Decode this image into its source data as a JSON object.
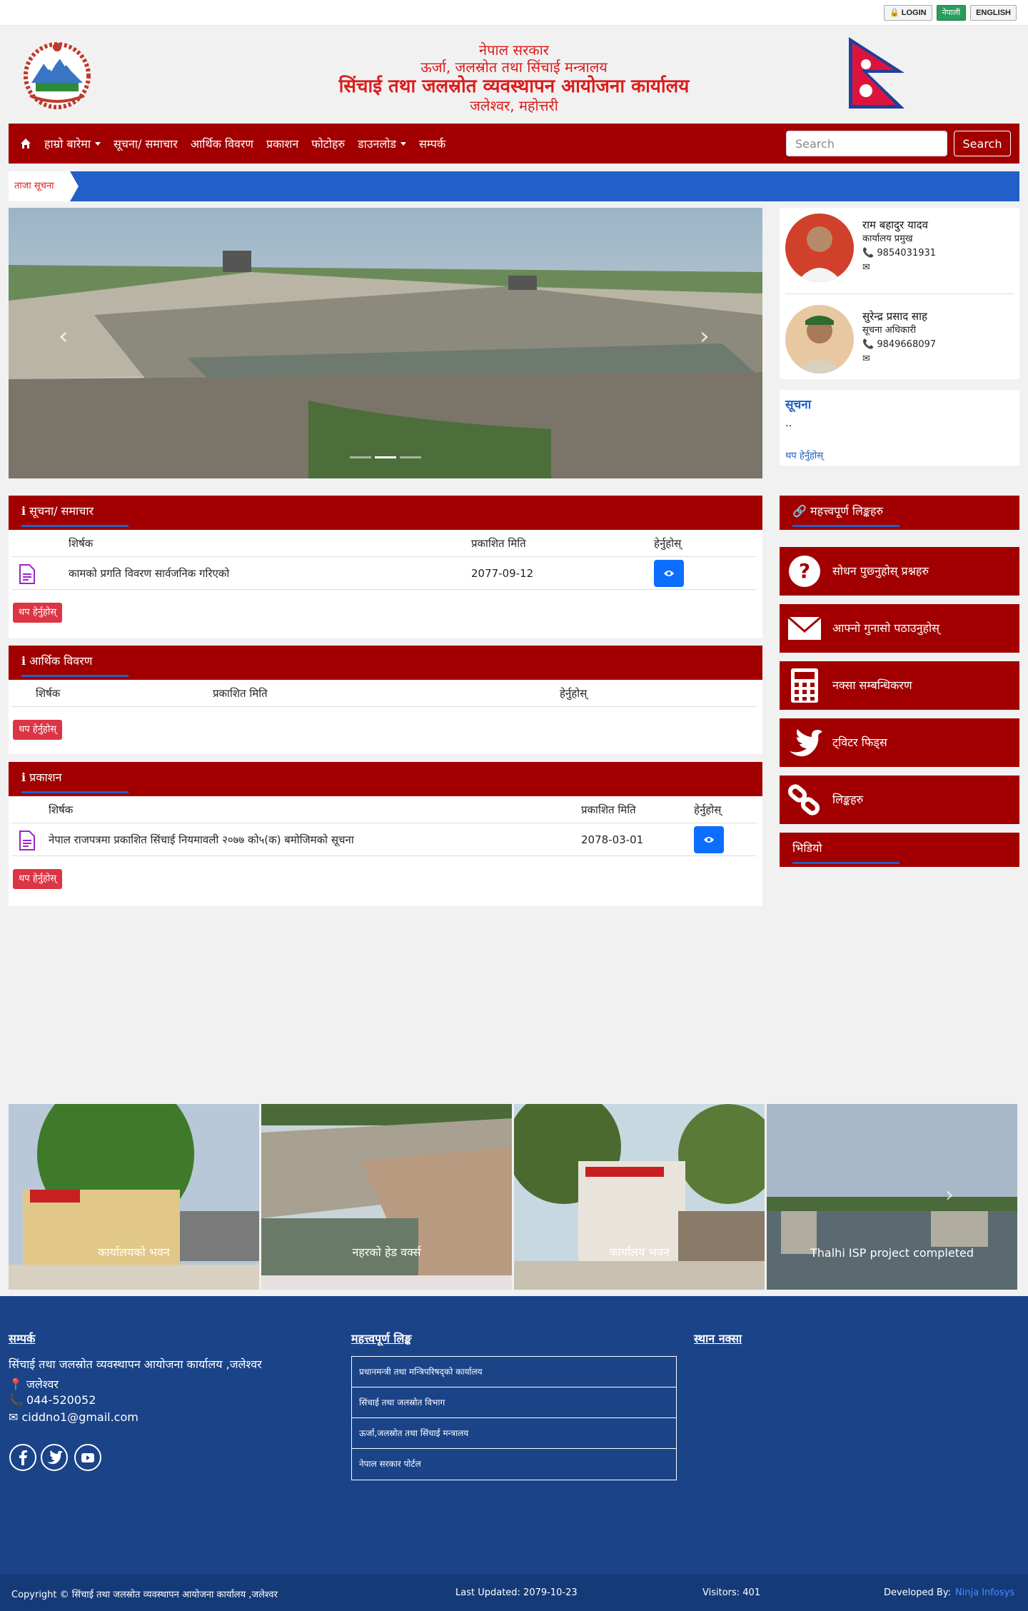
{
  "topbar": {
    "login": "🔒 LOGIN",
    "nepali": "नेपाली",
    "english": "ENGLISH"
  },
  "header": {
    "line1": "नेपाल सरकार",
    "line2": "ऊर्जा, जलस्रोत तथा सिंचाई मन्त्रालय",
    "line3": "सिंचाई तथा जलस्रोत व्यवस्थापन आयोजना कार्यालय",
    "line4": "जलेश्वर, महोत्तरी"
  },
  "nav": {
    "home_icon": "home-icon",
    "items": [
      "हाम्रो बारेमा",
      "सूचना/ समाचार",
      "आर्थिक विवरण",
      "प्रकाशन",
      "फोटोहरु",
      "डाउनलोड",
      "सम्पर्क"
    ],
    "search_placeholder": "Search",
    "search_button": "Search"
  },
  "ticker": {
    "label": "ताजा सूचना"
  },
  "staff": [
    {
      "name": "राम बहादुर यादव",
      "role": "कार्यालय प्रमुख",
      "phone": "📞 9854031931",
      "email": "✉"
    },
    {
      "name": "सुरेन्द्र प्रसाद साह",
      "role": "सूचना अधिकारी",
      "phone": "📞 9849668097",
      "email": "✉"
    }
  ],
  "notice": {
    "title": "सूचना",
    "text": "..",
    "more": "थप हेर्नुहोस्"
  },
  "panel_news": {
    "title": "सूचना/ समाचार",
    "columns": [
      "शिर्षक",
      "प्रकाशित मिति",
      "हेर्नुहोस्"
    ],
    "rows": [
      {
        "title": "कामको प्रगति विवरण सार्वजनिक गरिएको",
        "date": "2077-09-12"
      }
    ],
    "more": "थप हेर्नुहोस्"
  },
  "panel_finance": {
    "title": "आर्थिक विवरण",
    "columns": [
      "शिर्षक",
      "प्रकाशित मिति",
      "हेर्नुहोस्"
    ],
    "more": "थप हेर्नुहोस्"
  },
  "panel_pub": {
    "title": "प्रकाशन",
    "columns": [
      "शिर्षक",
      "प्रकाशित मिति",
      "हेर्नुहोस्"
    ],
    "rows": [
      {
        "title": "नेपाल राजपत्रमा प्रकाशित सिंचाई नियमावली २०७७ को५(क) बमोजिमको सूचना",
        "date": "2078-03-01"
      }
    ],
    "more": "थप हेर्नुहोस्"
  },
  "quick": {
    "title": "महत्त्वपूर्ण लिङ्कहरु",
    "links": [
      "सोधन पुछ्नुहोस् प्रश्नहरु",
      "आफ्नो गुनासो पठाउनुहोस्",
      "नक्सा सम्बन्धिकरण",
      "ट्विटर फिड्स",
      "लिङ्कहरु"
    ],
    "video_title": "भिडियो"
  },
  "gallery": [
    {
      "caption": "कार्यालयको भवन"
    },
    {
      "caption": "नहरको हेड वर्क्स"
    },
    {
      "caption": "कार्यालय भवन"
    },
    {
      "caption": "Thalhi ISP project completed"
    }
  ],
  "footer": {
    "contact_title": "सम्पर्क",
    "office": "सिंचाई तथा जलस्रोत व्यवस्थापन आयोजना कार्यालय ,जलेश्वर",
    "location": "📍 जलेश्वर",
    "phone": "📞 044-520052",
    "email": "✉ ciddno1@gmail.com",
    "links_title": "महत्त्वपूर्ण लिङ्क",
    "links": [
      "प्रधानमन्त्री तथा मन्त्रिपरिषद्को कार्यालय",
      "सिंचाई तथा जलस्रोत विभाग",
      "ऊर्जा,जलस्रोत तथा सिंचाई मन्त्रालय",
      "नेपाल सरकार पोर्टल"
    ],
    "map_title": "स्थान नक्सा"
  },
  "bottombar": {
    "copyright": "Copyright © सिंचाई तथा जलस्रोत व्यवस्थापन आयोजना कार्यालय ,जलेश्वर",
    "updated": "Last Updated: 2079-10-23",
    "visitors": "Visitors: 401",
    "dev_label": "Developed By:",
    "dev_name": "Ninja Infosys"
  },
  "colors": {
    "primary_red": "#a20000",
    "accent_blue": "#2060c8",
    "footer_blue": "#1a4388"
  }
}
